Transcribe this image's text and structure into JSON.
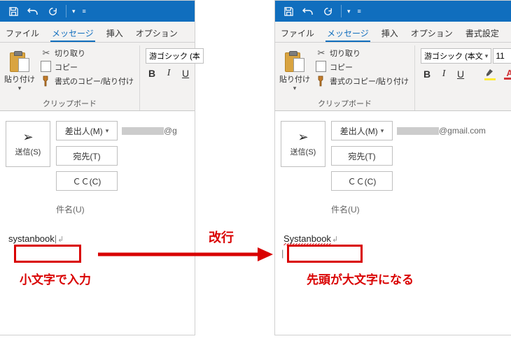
{
  "qat": {
    "save": "save-icon",
    "undo": "undo-icon",
    "redo": "redo-icon"
  },
  "tabs": {
    "file": "ファイル",
    "message": "メッセージ",
    "insert": "挿入",
    "options": "オプション",
    "format": "書式設定"
  },
  "ribbon": {
    "paste": "貼り付け",
    "cut": "切り取り",
    "copy": "コピー",
    "format_painter": "書式のコピー/貼り付け",
    "clipboard_group": "クリップボード",
    "font_name_left": "游ゴシック (本",
    "font_name_right": "游ゴシック (本文",
    "font_size": "11"
  },
  "compose": {
    "send": "送信(S)",
    "from": "差出人(M)",
    "to": "宛先(T)",
    "cc": "ＣＣ(C)",
    "subject_label": "件名(U)",
    "from_value_left": "@g",
    "from_value_right": "@gmail.com"
  },
  "body": {
    "left_text": "systanbook",
    "right_text": "Systanbook"
  },
  "annot": {
    "center_top": "改行",
    "left_caption": "小文字で入力",
    "right_caption": "先頭が大文字になる"
  }
}
